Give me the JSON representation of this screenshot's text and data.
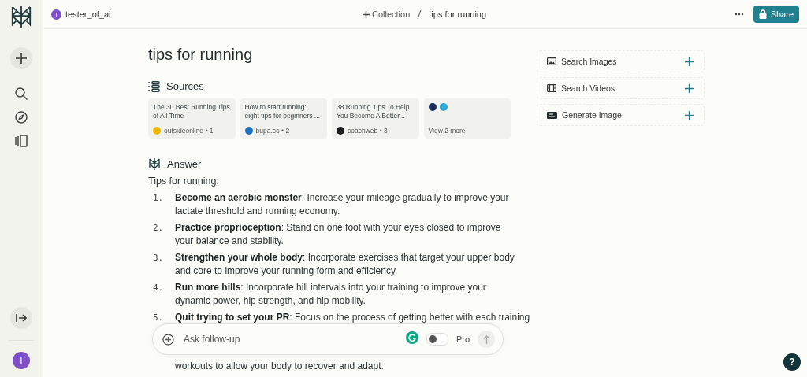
{
  "sidebar": {
    "avatar": "T"
  },
  "header": {
    "user": {
      "initial": "T",
      "name": "tester_of_ai"
    },
    "collection": "Collection",
    "breadcrumb": "tips for running",
    "share": "Share"
  },
  "query": "tips for running",
  "sources": {
    "heading": "Sources",
    "items": [
      {
        "title": "The 30 Best Running Tips of All Time",
        "domain": "outsideonline • 1",
        "color": "#f2b705"
      },
      {
        "title": "How to start running: eight tips for beginners ...",
        "domain": "bupa.co • 2",
        "color": "#1d72c4"
      },
      {
        "title": "38 Running Tips To Help You Become A Better...",
        "domain": "coachweb • 3",
        "color": "#1f1f1f"
      }
    ],
    "more": {
      "label": "View 2 more",
      "favicons": [
        {
          "color": "#1b2f5e"
        },
        {
          "color": "#2ba9d9"
        }
      ]
    }
  },
  "answer": {
    "heading": "Answer",
    "intro": "Tips for running:",
    "items": [
      {
        "number": "1.",
        "text": "**Become an aerobic monster**: Increase your mileage gradually to improve your lactate threshold and running economy."
      },
      {
        "number": "2.",
        "text": "**Practice proprioception**: Stand on one foot with your eyes closed to improve your balance and stability."
      },
      {
        "number": "3.",
        "text": "**Strengthen your whole body**: Incorporate exercises that target your upper body and core to improve your running form and efficiency."
      },
      {
        "number": "4.",
        "text": "**Run more hills**: Incorporate hill intervals into your training to improve your dynamic power, hip strength, and hip mobility."
      },
      {
        "number": "5.",
        "text": "**Quit trying to set your PR**: Focus on the process of getting better with each training",
        "continuation": "workouts to allow your body to recover and adapt."
      }
    ]
  },
  "actions": [
    {
      "kind": "images",
      "label": "Search Images"
    },
    {
      "kind": "videos",
      "label": "Search Videos"
    },
    {
      "kind": "generate",
      "label": "Generate Image"
    }
  ],
  "followup": {
    "placeholder": "Ask follow-up",
    "pro": {
      "label": "Pro",
      "on": false
    }
  },
  "help": "?"
}
